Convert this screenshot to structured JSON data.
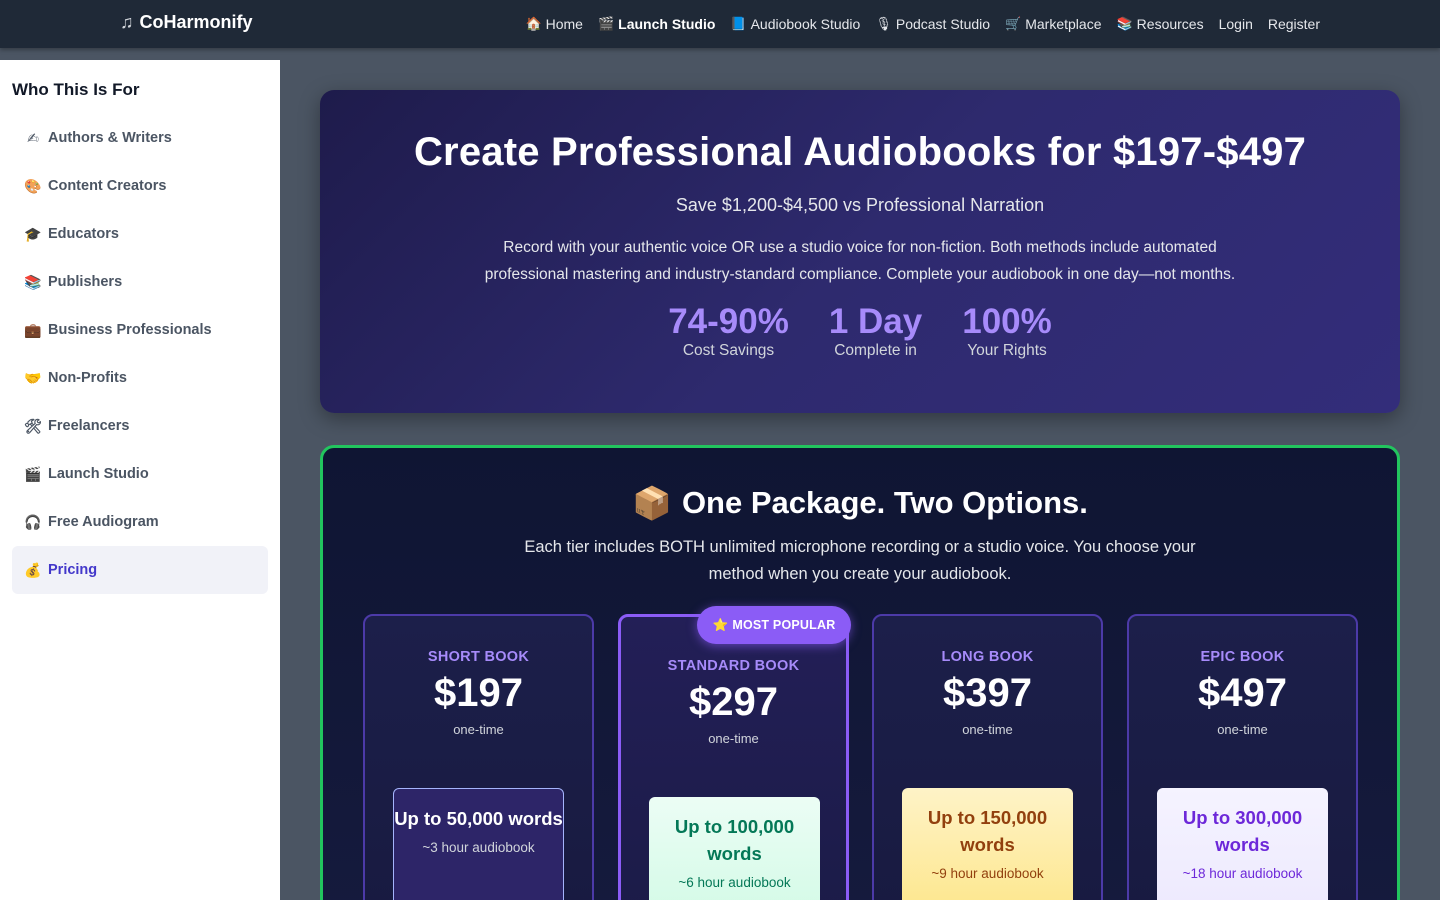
{
  "brand": {
    "icon": "music-note-icon",
    "name": "CoHarmonify"
  },
  "nav": [
    {
      "icon": "house-icon",
      "glyph": "🏠",
      "label": "Home"
    },
    {
      "icon": "clapper-icon",
      "glyph": "🎬",
      "label": "Launch Studio",
      "active": true
    },
    {
      "icon": "book-icon",
      "glyph": "📘",
      "label": "Audiobook Studio"
    },
    {
      "icon": "microphone-icon",
      "glyph": "🎙️",
      "label": "Podcast Studio"
    },
    {
      "icon": "cart-icon",
      "glyph": "🛒",
      "label": "Marketplace"
    },
    {
      "icon": "books-icon",
      "glyph": "📚",
      "label": "Resources"
    },
    {
      "label": "Login"
    },
    {
      "label": "Register"
    }
  ],
  "sidebar": {
    "title": "Who This Is For",
    "items": [
      {
        "icon": "writing-hand-icon",
        "glyph": "✍️",
        "label": "Authors & Writers"
      },
      {
        "icon": "palette-icon",
        "glyph": "🎨",
        "label": "Content Creators"
      },
      {
        "icon": "graduation-cap-icon",
        "glyph": "🎓",
        "label": "Educators"
      },
      {
        "icon": "books-icon",
        "glyph": "📚",
        "label": "Publishers"
      },
      {
        "icon": "briefcase-icon",
        "glyph": "💼",
        "label": "Business Professionals"
      },
      {
        "icon": "handshake-icon",
        "glyph": "🤝",
        "label": "Non-Profits"
      },
      {
        "icon": "tools-icon",
        "glyph": "🛠️",
        "label": "Freelancers"
      },
      {
        "icon": "clapper-icon",
        "glyph": "🎬",
        "label": "Launch Studio"
      },
      {
        "icon": "headphones-icon",
        "glyph": "🎧",
        "label": "Free Audiogram"
      },
      {
        "icon": "money-bag-icon",
        "glyph": "💰",
        "label": "Pricing",
        "active": true
      }
    ]
  },
  "hero": {
    "title": "Create Professional Audiobooks for $197-$497",
    "subtitle": "Save $1,200-$4,500 vs Professional Narration",
    "description": "Record with your authentic voice OR use a studio voice for non-fiction. Both methods include automated professional mastering and industry-standard compliance. Complete your audiobook in one day—not months.",
    "stats": [
      {
        "value": "74-90%",
        "label": "Cost Savings"
      },
      {
        "value": "1 Day",
        "label": "Complete in"
      },
      {
        "value": "100%",
        "label": "Your Rights"
      }
    ]
  },
  "package": {
    "icon": "package-icon",
    "title": "One Package. Two Options.",
    "description": "Each tier includes BOTH unlimited microphone recording or a studio voice. You choose your method when you create your audiobook.",
    "badge": {
      "icon": "star-icon",
      "label": "MOST POPULAR"
    },
    "tiers": [
      {
        "name": "SHORT BOOK",
        "price": "$197",
        "period": "one-time",
        "words": "Up to 50,000 words",
        "hours": "~3 hour audiobook"
      },
      {
        "name": "STANDARD BOOK",
        "price": "$297",
        "period": "one-time",
        "words": "Up to 100,000 words",
        "hours": "~6 hour audiobook"
      },
      {
        "name": "LONG BOOK",
        "price": "$397",
        "period": "one-time",
        "words": "Up to 150,000 words",
        "hours": "~9 hour audiobook"
      },
      {
        "name": "EPIC BOOK",
        "price": "$497",
        "period": "one-time",
        "words": "Up to 300,000 words",
        "hours": "~18 hour audiobook"
      }
    ]
  },
  "colors": {
    "accent": "#8b5cf6",
    "package_border": "#22c55e",
    "nav_bg": "#1f2937"
  }
}
